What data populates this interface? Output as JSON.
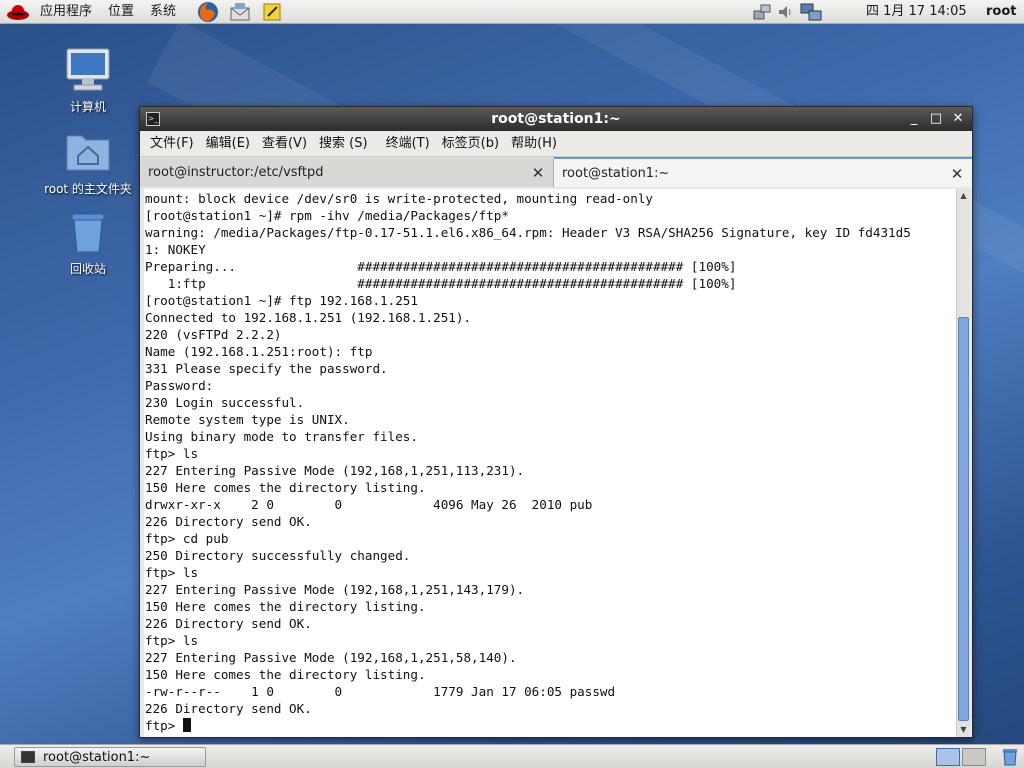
{
  "top_panel": {
    "menus": [
      "应用程序",
      "位置",
      "系统"
    ],
    "clock": "四 1月 17 14:05",
    "user": "root"
  },
  "desktop": {
    "icons": [
      {
        "label": "计算机"
      },
      {
        "label": "root 的主文件夹"
      },
      {
        "label": "回收站"
      }
    ]
  },
  "window": {
    "title": "root@station1:~",
    "menus": [
      "文件(F)",
      "编辑(E)",
      "查看(V)",
      "搜索 (S)",
      "终端(T)",
      "标签页(b)",
      "帮助(H)"
    ],
    "tabs": [
      {
        "label": "root@instructor:/etc/vsftpd",
        "active": false
      },
      {
        "label": "root@station1:~",
        "active": true
      }
    ]
  },
  "terminal": {
    "lines": [
      "mount: block device /dev/sr0 is write-protected, mounting read-only",
      "[root@station1 ~]# rpm -ihv /media/Packages/ftp*",
      "warning: /media/Packages/ftp-0.17-51.1.el6.x86_64.rpm: Header V3 RSA/SHA256 Signature, key ID fd431d5",
      "1: NOKEY",
      "Preparing...                ########################################### [100%]",
      "   1:ftp                    ########################################### [100%]",
      "[root@station1 ~]# ftp 192.168.1.251",
      "Connected to 192.168.1.251 (192.168.1.251).",
      "220 (vsFTPd 2.2.2)",
      "Name (192.168.1.251:root): ftp",
      "331 Please specify the password.",
      "Password:",
      "230 Login successful.",
      "Remote system type is UNIX.",
      "Using binary mode to transfer files.",
      "ftp> ls",
      "227 Entering Passive Mode (192,168,1,251,113,231).",
      "150 Here comes the directory listing.",
      "drwxr-xr-x    2 0        0            4096 May 26  2010 pub",
      "226 Directory send OK.",
      "ftp> cd pub",
      "250 Directory successfully changed.",
      "ftp> ls",
      "227 Entering Passive Mode (192,168,1,251,143,179).",
      "150 Here comes the directory listing.",
      "226 Directory send OK.",
      "ftp> ls",
      "227 Entering Passive Mode (192,168,1,251,58,140).",
      "150 Here comes the directory listing.",
      "-rw-r--r--    1 0        0            1779 Jan 17 06:05 passwd",
      "226 Directory send OK."
    ],
    "prompt": "ftp> "
  },
  "bottom_panel": {
    "task_label": "root@station1:~"
  }
}
